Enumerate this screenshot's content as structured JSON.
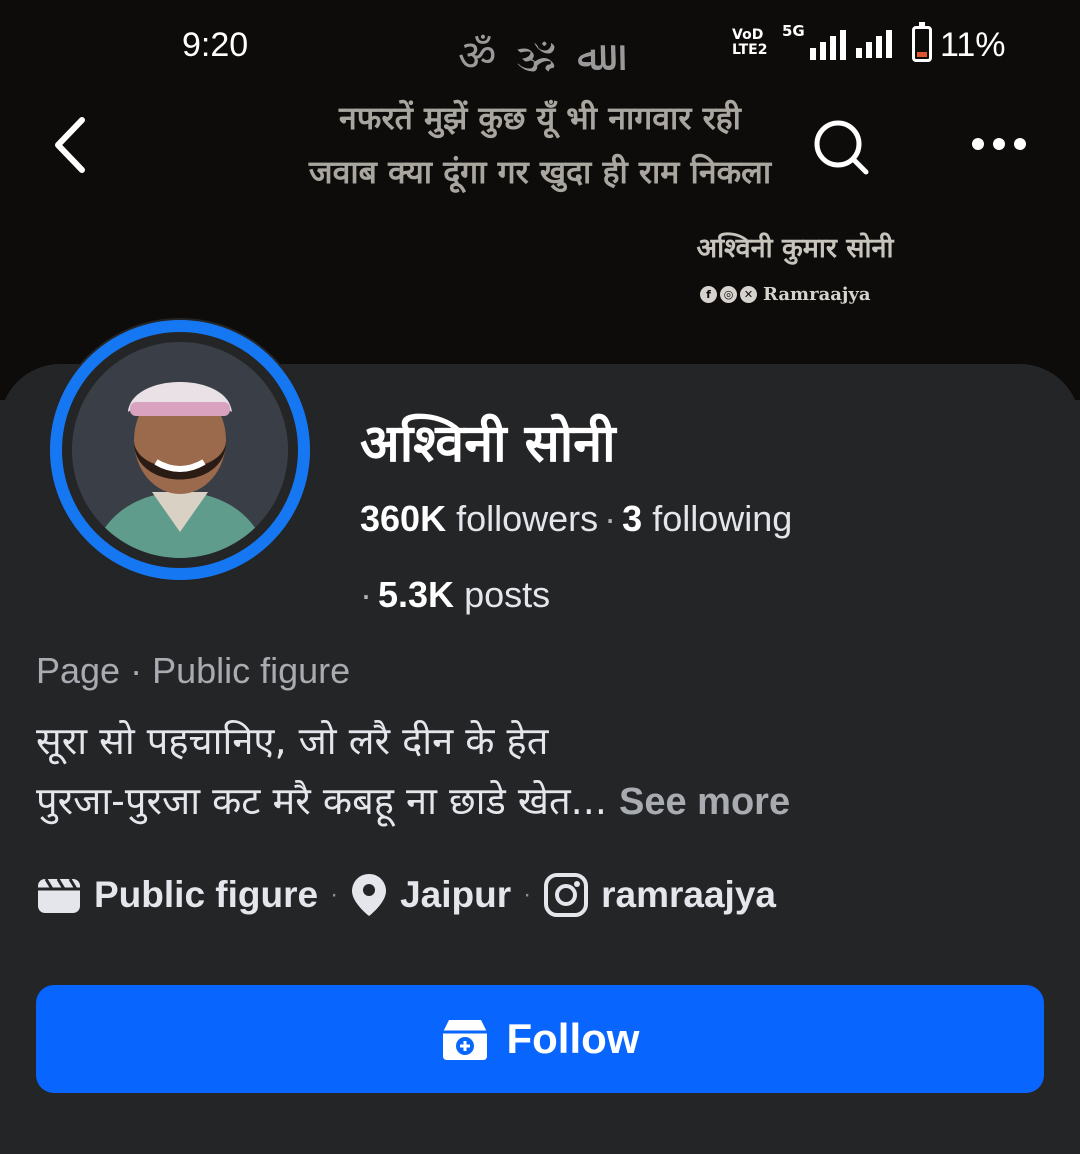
{
  "status_bar": {
    "time": "9:20",
    "network_top": "VoD",
    "network_bottom": "LTE2",
    "net_5g": "5G",
    "battery": "11%"
  },
  "cover": {
    "symbols": "ॐ 🕉 ﷲ",
    "quote_line1": "नफरतें मुझें कुछ यूँ भी नागवार रही",
    "quote_line2": "जवाब क्या दूंगा गर खुदा ही राम निकला",
    "credit": "अश्विनी कुमार सोनी",
    "handle": "Ramraajya"
  },
  "profile": {
    "name": "अश्विनी सोनी",
    "followers_count": "360K",
    "followers_label": "followers",
    "following_count": "3",
    "following_label": "following",
    "posts_count": "5.3K",
    "posts_label": "posts",
    "category": "Page · Public figure",
    "bio_line1": "सूरा सो पहचानिए, जो लरै दीन के हेत",
    "bio_line2": "पुरजा-पुरजा कट मरै कबहू ना छाडे खेत...",
    "see_more": "See more"
  },
  "details": {
    "category": "Public figure",
    "location": "Jaipur",
    "instagram": "ramraajya"
  },
  "actions": {
    "follow_label": "Follow"
  },
  "colors": {
    "accent": "#0866ff",
    "ring": "#1677f2",
    "background": "#242527",
    "cover": "#0e0c0b"
  }
}
